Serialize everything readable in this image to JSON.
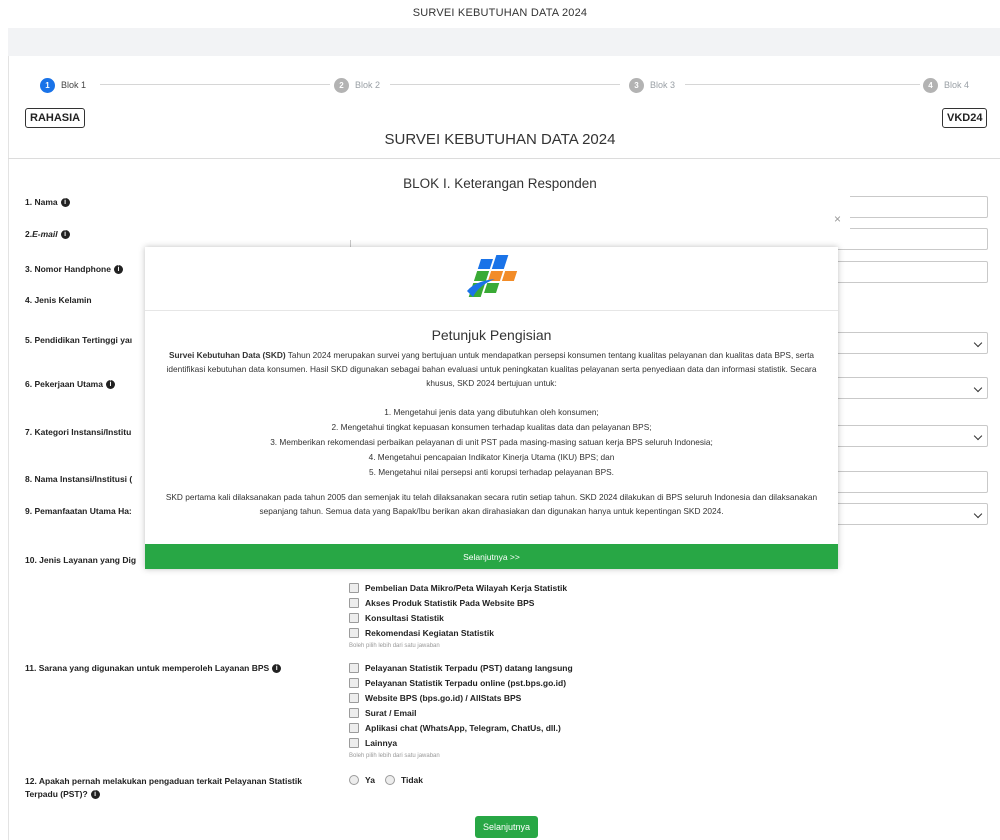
{
  "page_title": "SURVEI KEBUTUHAN DATA 2024",
  "steps": [
    {
      "num": "1",
      "label": "Blok 1",
      "active": true
    },
    {
      "num": "2",
      "label": "Blok 2"
    },
    {
      "num": "3",
      "label": "Blok 3"
    },
    {
      "num": "4",
      "label": "Blok 4"
    }
  ],
  "header": {
    "left_tag": "RAHASIA",
    "right_tag": "VKD24",
    "title": "SURVEI KEBUTUHAN DATA 2024",
    "blok_title": "BLOK I. Keterangan Responden"
  },
  "questions": [
    {
      "label": "1. Nama",
      "info": true
    },
    {
      "label": "2. ",
      "label_em": "E-mail",
      "info": true
    },
    {
      "label": "3. Nomor Handphone",
      "info": true
    },
    {
      "label": "4. Jenis Kelamin"
    },
    {
      "label": "5. Pendidikan Tertinggi yaı"
    },
    {
      "label": "6. Pekerjaan Utama",
      "info": true
    },
    {
      "label": "7. Kategori Instansi/Institu"
    },
    {
      "label": "8. Nama Instansi/Institusi ("
    },
    {
      "label": "9. Pemanfaatan Utama Ha:"
    },
    {
      "label": "10. Jenis Layanan yang Dig"
    },
    {
      "label": "11. Sarana yang digunakan untuk memperoleh Layanan BPS",
      "info": true
    },
    {
      "label": "12. Apakah pernah melakukan pengaduan terkait Pelayanan Statistik",
      "label2": "Terpadu (PST)?",
      "info": true
    }
  ],
  "layanan_options": [
    "Pembelian Data Mikro/Peta Wilayah Kerja Statistik",
    "Akses Produk Statistik Pada Website BPS",
    "Konsultasi Statistik",
    "Rekomendasi Kegiatan Statistik"
  ],
  "sarana_options": [
    "Pelayanan Statistik Terpadu (PST) datang langsung",
    "Pelayanan Statistik Terpadu online (pst.bps.go.id)",
    "Website BPS (bps.go.id) / AllStats BPS",
    "Surat / Email",
    "Aplikasi chat (WhatsApp, Telegram, ChatUs, dll.)",
    "Lainnya"
  ],
  "hint": "Boleh pilih lebih dari satu jawaban",
  "radio": {
    "yes": "Ya",
    "no": "Tidak"
  },
  "submit_label": "Selanjutnya",
  "modal": {
    "close": "×",
    "heading": "Petunjuk Pengisian",
    "intro_bold": "Survei Kebutuhan Data (SKD)",
    "intro_rest": " Tahun 2024 merupakan survei yang bertujuan untuk mendapatkan persepsi konsumen tentang kualitas pelayanan dan kualitas data BPS, serta identifikasi kebutuhan data konsumen. Hasil SKD digunakan sebagai bahan evaluasi untuk peningkatan kualitas pelayanan serta penyediaan data dan informasi statistik. Secara khusus, SKD 2024 bertujuan untuk:",
    "goals": [
      "1. Mengetahui jenis data yang dibutuhkan oleh konsumen;",
      "2. Mengetahui tingkat kepuasan konsumen terhadap kualitas data dan pelayanan BPS;",
      "3. Memberikan rekomendasi perbaikan pelayanan di unit PST pada masing-masing satuan kerja BPS seluruh Indonesia;",
      "4. Mengetahui pencapaian Indikator Kinerja Utama (IKU) BPS; dan",
      "5. Mengetahui nilai persepsi anti korupsi terhadap pelayanan BPS."
    ],
    "closing": "SKD pertama kali dilaksanakan pada tahun 2005 dan semenjak itu telah dilaksanakan secara rutin setiap tahun. SKD 2024 dilakukan di BPS seluruh Indonesia dan dilaksanakan sepanjang tahun. Semua data yang Bapak/Ibu berikan akan dirahasiakan dan digunakan hanya untuk kepentingan SKD 2024.",
    "next_label": "Selanjutnya >>"
  },
  "colors": {
    "primary": "#1a73e8",
    "success": "#28a745"
  },
  "icons": [
    "info-icon",
    "close-icon",
    "bps-logo",
    "chevron-down-icon"
  ]
}
